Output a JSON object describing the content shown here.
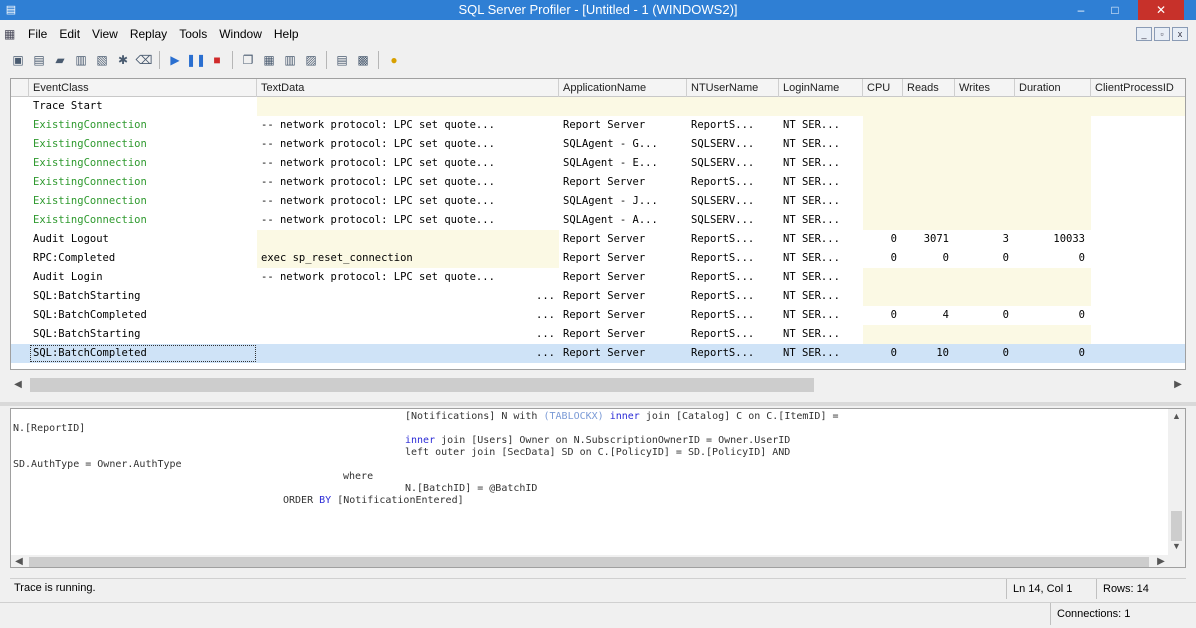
{
  "window": {
    "title": "SQL Server Profiler - [Untitled - 1 (WINDOWS2)]",
    "minimize": "–",
    "restore": "□",
    "close": "✕"
  },
  "menu": [
    "File",
    "Edit",
    "View",
    "Replay",
    "Tools",
    "Window",
    "Help"
  ],
  "columns": [
    "EventClass",
    "TextData",
    "ApplicationName",
    "NTUserName",
    "LoginName",
    "CPU",
    "Reads",
    "Writes",
    "Duration",
    "ClientProcessID"
  ],
  "rows": [
    {
      "event": "Trace Start",
      "text": "",
      "app": "",
      "nt": "",
      "login": "",
      "cpu": "",
      "reads": "",
      "writes": "",
      "duration": "",
      "green": false
    },
    {
      "event": "ExistingConnection",
      "text": "-- network protocol: LPC  set quote...",
      "app": "Report Server",
      "nt": "ReportS...",
      "login": "NT SER...",
      "cpu": "",
      "reads": "",
      "writes": "",
      "duration": "",
      "green": true
    },
    {
      "event": "ExistingConnection",
      "text": "-- network protocol: LPC  set quote...",
      "app": "SQLAgent - G...",
      "nt": "SQLSERV...",
      "login": "NT SER...",
      "cpu": "",
      "reads": "",
      "writes": "",
      "duration": "",
      "green": true
    },
    {
      "event": "ExistingConnection",
      "text": "-- network protocol: LPC  set quote...",
      "app": "SQLAgent - E...",
      "nt": "SQLSERV...",
      "login": "NT SER...",
      "cpu": "",
      "reads": "",
      "writes": "",
      "duration": "",
      "green": true
    },
    {
      "event": "ExistingConnection",
      "text": "-- network protocol: LPC  set quote...",
      "app": "Report Server",
      "nt": "ReportS...",
      "login": "NT SER...",
      "cpu": "",
      "reads": "",
      "writes": "",
      "duration": "",
      "green": true
    },
    {
      "event": "ExistingConnection",
      "text": "-- network protocol: LPC  set quote...",
      "app": "SQLAgent - J...",
      "nt": "SQLSERV...",
      "login": "NT SER...",
      "cpu": "",
      "reads": "",
      "writes": "",
      "duration": "",
      "green": true
    },
    {
      "event": "ExistingConnection",
      "text": "-- network protocol: LPC  set quote...",
      "app": "SQLAgent - A...",
      "nt": "SQLSERV...",
      "login": "NT SER...",
      "cpu": "",
      "reads": "",
      "writes": "",
      "duration": "",
      "green": true
    },
    {
      "event": "Audit Logout",
      "text": "",
      "app": "Report Server",
      "nt": "ReportS...",
      "login": "NT SER...",
      "cpu": "0",
      "reads": "3071",
      "writes": "3",
      "duration": "10033",
      "green": false
    },
    {
      "event": "RPC:Completed",
      "text": "exec sp_reset_connection",
      "app": "Report Server",
      "nt": "ReportS...",
      "login": "NT SER...",
      "cpu": "0",
      "reads": "0",
      "writes": "0",
      "duration": "0",
      "green": false
    },
    {
      "event": "Audit Login",
      "text": "-- network protocol: LPC  set quote...",
      "app": "Report Server",
      "nt": "ReportS...",
      "login": "NT SER...",
      "cpu": "",
      "reads": "",
      "writes": "",
      "duration": "",
      "green": false
    },
    {
      "event": "SQL:BatchStarting",
      "text": "...",
      "app": "Report Server",
      "nt": "ReportS...",
      "login": "NT SER...",
      "cpu": "",
      "reads": "",
      "writes": "",
      "duration": "",
      "green": false
    },
    {
      "event": "SQL:BatchCompleted",
      "text": "...",
      "app": "Report Server",
      "nt": "ReportS...",
      "login": "NT SER...",
      "cpu": "0",
      "reads": "4",
      "writes": "0",
      "duration": "0",
      "green": false
    },
    {
      "event": "SQL:BatchStarting",
      "text": "...",
      "app": "Report Server",
      "nt": "ReportS...",
      "login": "NT SER...",
      "cpu": "",
      "reads": "",
      "writes": "",
      "duration": "",
      "green": false
    },
    {
      "event": "SQL:BatchCompleted",
      "text": "...",
      "app": "Report Server",
      "nt": "ReportS...",
      "login": "NT SER...",
      "cpu": "0",
      "reads": "10",
      "writes": "0",
      "duration": "0",
      "green": false,
      "selected": true
    }
  ],
  "sql": {
    "l1a": "[Notifications] N with ",
    "l1b": "(TABLOCKX)",
    "l1c": " inner",
    "l1d": " join [Catalog] C on C.[ItemID] =",
    "l2": "N.[ReportID]",
    "l3a": "inner",
    "l3b": " join [Users] Owner on N.SubscriptionOwnerID = Owner.UserID",
    "l4": "left outer join [SecData] SD on C.[PolicyID] = SD.[PolicyID] AND",
    "l5": "SD.AuthType = Owner.AuthType",
    "l6": "where",
    "l7": "N.[BatchID] = @BatchID",
    "l8a": "ORDER ",
    "l8b": "BY",
    "l8c": " [NotificationEntered]"
  },
  "status": {
    "message": "Trace is running.",
    "position": "Ln 14, Col 1",
    "rows": "Rows: 14",
    "connections": "Connections: 1"
  },
  "icons": {
    "app": "profiler-icon",
    "scroll_left": "◀",
    "scroll_right": "▶",
    "scroll_up": "▲",
    "scroll_down": "▼"
  }
}
